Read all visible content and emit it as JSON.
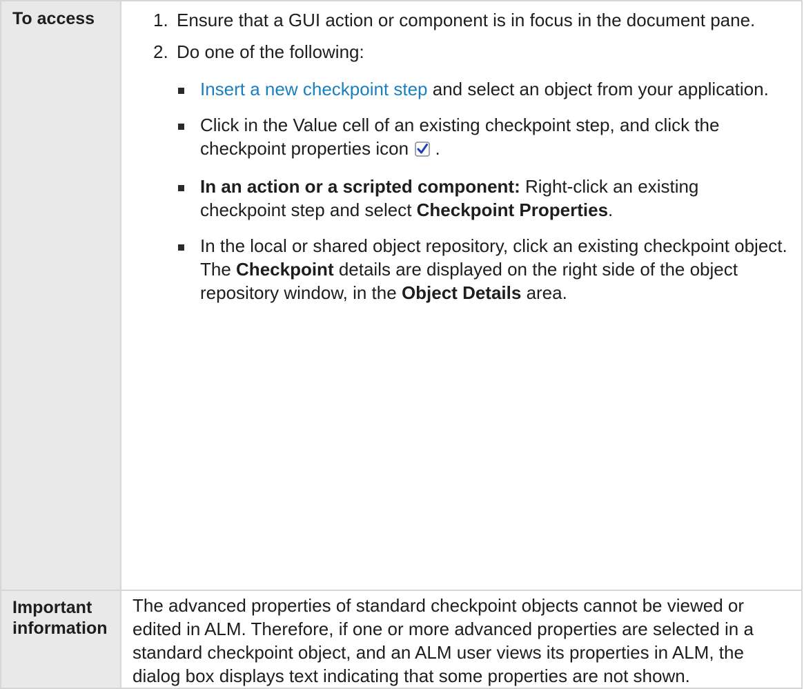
{
  "rows": [
    {
      "header": "To access",
      "steps": [
        {
          "num": "1.",
          "text": "Ensure that a GUI action or component is in focus in the document pane."
        },
        {
          "num": "2.",
          "text": "Do one of the following:",
          "options": {
            "o1": {
              "link": "Insert a new checkpoint step",
              "rest": " and select an object from your application."
            },
            "o2": {
              "text": "Click in the Value cell of an existing checkpoint step, and click the checkpoint properties icon",
              "icon": "checkbox-checked-icon",
              "after": "."
            },
            "o3": {
              "bold1": "In an action or a scripted component:",
              "text1": " Right-click an existing checkpoint step and select ",
              "bold2": "Checkpoint Properties",
              "text2": "."
            },
            "o4": {
              "text1": "In the local or shared object repository, click an existing checkpoint object. The ",
              "bold1": "Checkpoint",
              "text2": " details are displayed on the right side of the object repository window, in the ",
              "bold2": "Object Details",
              "text3": " area."
            }
          }
        }
      ]
    },
    {
      "header": "Important information",
      "text": "The advanced properties of standard checkpoint objects cannot be viewed or edited in ALM. Therefore, if one or more advanced properties are selected in a standard checkpoint object, and an ALM user views its properties in ALM, the dialog box displays text indicating that some properties are not shown."
    }
  ],
  "colors": {
    "link": "#1a7fc0",
    "header_bg": "#e9e9e9",
    "border": "#d6d6d6",
    "icon_check": "#1f3fb8"
  }
}
